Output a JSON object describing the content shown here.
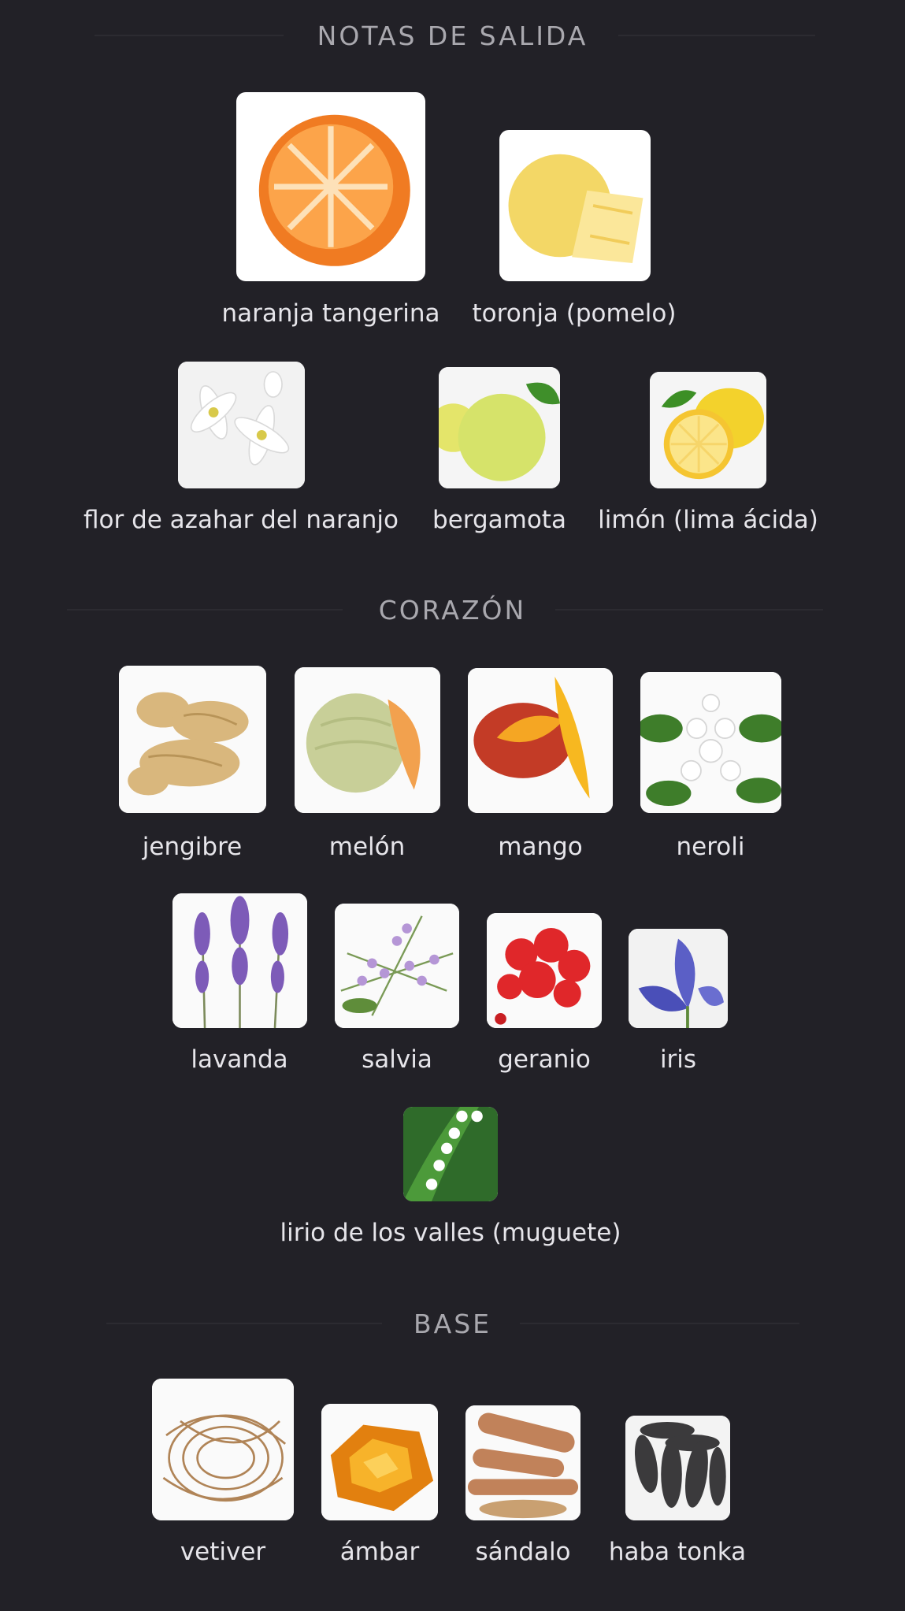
{
  "sections": {
    "top": {
      "title": "NOTAS DE SALIDA",
      "notes": [
        {
          "label": "naranja tangerina",
          "icon": "tangerine-icon"
        },
        {
          "label": "toronja (pomelo)",
          "icon": "grapefruit-icon"
        },
        {
          "label": "flor de azahar del naranjo",
          "icon": "orange-blossom-icon"
        },
        {
          "label": "bergamota",
          "icon": "bergamot-icon"
        },
        {
          "label": "limón (lima ácida)",
          "icon": "lemon-icon"
        }
      ]
    },
    "heart": {
      "title": "CORAZÓN",
      "notes": [
        {
          "label": "jengibre",
          "icon": "ginger-icon"
        },
        {
          "label": "melón",
          "icon": "melon-icon"
        },
        {
          "label": "mango",
          "icon": "mango-icon"
        },
        {
          "label": "neroli",
          "icon": "neroli-icon"
        },
        {
          "label": "lavanda",
          "icon": "lavender-icon"
        },
        {
          "label": "salvia",
          "icon": "sage-icon"
        },
        {
          "label": "geranio",
          "icon": "geranium-icon"
        },
        {
          "label": "iris",
          "icon": "iris-icon"
        },
        {
          "label": "lirio de los valles (muguete)",
          "icon": "lily-of-the-valley-icon"
        }
      ]
    },
    "base": {
      "title": "BASE",
      "notes": [
        {
          "label": "vetiver",
          "icon": "vetiver-icon"
        },
        {
          "label": "ámbar",
          "icon": "amber-icon"
        },
        {
          "label": "sándalo",
          "icon": "sandalwood-icon"
        },
        {
          "label": "haba tonka",
          "icon": "tonka-bean-icon"
        }
      ]
    }
  },
  "colors": {
    "background": "#222127",
    "heading": "#a9a8ae",
    "label": "#e6e5ea"
  }
}
